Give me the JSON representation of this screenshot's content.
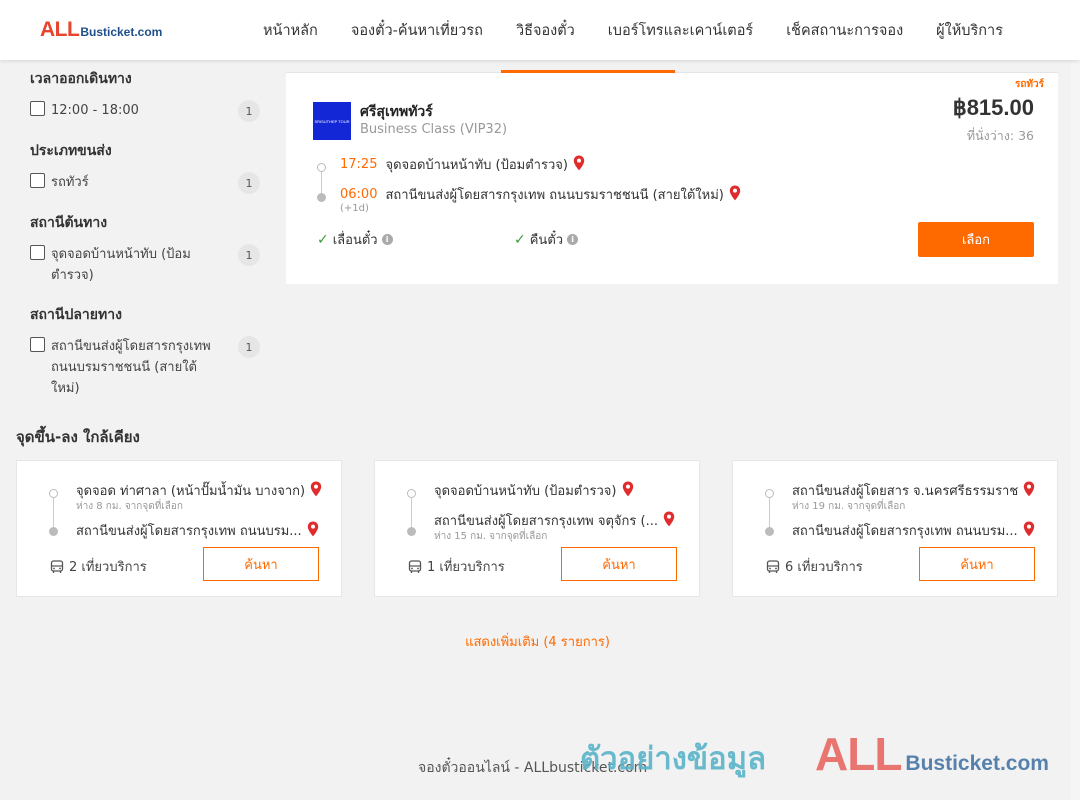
{
  "header": {
    "logo_all": "ALL",
    "logo_rest": "Busticket.com",
    "nav": [
      "หน้าหลัก",
      "จองตั๋ว-ค้นหาเที่ยวรถ",
      "วิธีจองตั๋ว",
      "เบอร์โทรและเคาน์เตอร์",
      "เช็คสถานะการจอง",
      "ผู้ให้บริการ"
    ]
  },
  "filters": {
    "departure_time": {
      "title": "เวลาออกเดินทาง",
      "options": [
        {
          "label": "12:00 - 18:00",
          "count": "1"
        }
      ]
    },
    "transport_type": {
      "title": "ประเภทขนส่ง",
      "options": [
        {
          "label": "รถทัวร์",
          "count": "1"
        }
      ]
    },
    "origin": {
      "title": "สถานีต้นทาง",
      "options": [
        {
          "label": "จุดจอดบ้านหน้าทับ (ป้อมตำรวจ)",
          "count": "1"
        }
      ]
    },
    "destination": {
      "title": "สถานีปลายทาง",
      "options": [
        {
          "label": "สถานีขนส่งผู้โดยสารกรุงเทพ ถนนบรมราชชนนี (สายใต้ใหม่)",
          "count": "1"
        }
      ]
    }
  },
  "trip": {
    "tag": "รถทัวร์",
    "operator_logo_text": "SRISUTHEP TOUR",
    "operator": "ศรีสุเทพทัวร์",
    "class": "Business Class (VIP32)",
    "price": "฿815.00",
    "seats": "ที่นั่งว่าง: 36",
    "depart_time": "17:25",
    "depart_stop": "จุดจอดบ้านหน้าทับ (ป้อมตำรวจ)",
    "arrive_time": "06:00",
    "arrive_stop": "สถานีขนส่งผู้โดยสารกรุงเทพ ถนนบรมราชชนนี (สายใต้ใหม่)",
    "plus_day": "(+1d)",
    "perk_reschedule": "เลื่อนตั๋ว",
    "perk_refund": "คืนตั๋ว",
    "select_label": "เลือก"
  },
  "nearby": {
    "title": "จุดขึ้น-ลง ใกล้เคียง",
    "cards": [
      {
        "from": "จุดจอด ท่าศาลา (หน้าปั๊มน้ำมัน บางจาก)",
        "from_note": "ห่าง 8 กม. จากจุดที่เลือก",
        "to": "สถานีขนส่งผู้โดยสารกรุงเทพ ถนนบรม...",
        "to_note": "",
        "trips": "2 เที่ยวบริการ",
        "search": "ค้นหา"
      },
      {
        "from": "จุดจอดบ้านหน้าทับ (ป้อมตำรวจ)",
        "from_note": "",
        "to": "สถานีขนส่งผู้โดยสารกรุงเทพ จตุจักร (...",
        "to_note": "ห่าง 15 กม. จากจุดที่เลือก",
        "trips": "1 เที่ยวบริการ",
        "search": "ค้นหา"
      },
      {
        "from": "สถานีขนส่งผู้โดยสาร จ.นครศรีธรรมราช",
        "from_note": "ห่าง 19 กม. จากจุดที่เลือก",
        "to": "สถานีขนส่งผู้โดยสารกรุงเทพ ถนนบรม...",
        "to_note": "",
        "trips": "6 เที่ยวบริการ",
        "search": "ค้นหา"
      }
    ],
    "show_more": "แสดงเพิ่มเติม (4 รายการ)"
  },
  "footer": {
    "text": "จองตั๋วออนไลน์ - ALLbusticket.com"
  },
  "watermark": {
    "text": "ตัวอย่างข้อมูล",
    "logo_all": "ALL",
    "logo_rest": "Busticket.com"
  },
  "colors": {
    "accent": "#ff6a00",
    "logo_red": "#e8442c",
    "logo_blue": "#1f4f8a",
    "pin_red": "#e02c2c",
    "check_green": "#3a9a3a"
  }
}
